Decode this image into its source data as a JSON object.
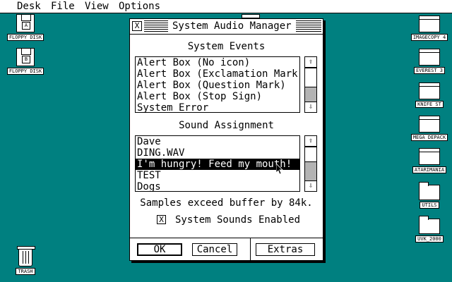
{
  "menubar": {
    "items": [
      "Desk",
      "File",
      "View",
      "Options"
    ]
  },
  "desktop": {
    "left_icons": [
      {
        "label": "FLOPPY DISK",
        "icon": "floppy-drive-icon",
        "letter": "A"
      },
      {
        "label": "FLOPPY DISK",
        "icon": "floppy-drive-icon",
        "letter": "B"
      }
    ],
    "right_icons": [
      {
        "label": "IMAGECOPY 4",
        "icon": "program-icon"
      },
      {
        "label": "EVEREST 3",
        "icon": "program-icon"
      },
      {
        "label": "KNIFE ST",
        "icon": "program-icon"
      },
      {
        "label": "MEGA DEPACK",
        "icon": "program-icon"
      },
      {
        "label": "ATARIMANIA",
        "icon": "program-icon"
      },
      {
        "label": "UTILS",
        "icon": "folder-icon"
      },
      {
        "label": "UVK_2000",
        "icon": "folder-icon"
      }
    ],
    "trash": {
      "label": "TRASH",
      "icon": "trash-icon"
    }
  },
  "dialog": {
    "title": "System Audio Manager",
    "close_glyph": "X",
    "events_heading": "System Events",
    "events": [
      "Alert Box (No icon)",
      "Alert Box (Exclamation Mark)",
      "Alert Box (Question Mark)",
      "Alert Box (Stop Sign)",
      "System Error"
    ],
    "assignment_heading": "Sound Assignment",
    "sounds": [
      "Dave",
      "DING.WAV",
      "I'm hungry! Feed my mouth!",
      "TEST",
      "Dogs"
    ],
    "selected_sound_index": 2,
    "scroll_up_glyph": "⇧",
    "scroll_down_glyph": "⇩",
    "status": "Samples exceed buffer by 84k.",
    "checkbox": {
      "label": "System Sounds Enabled",
      "checked": true,
      "glyph": "X"
    },
    "buttons": {
      "ok": "OK",
      "cancel": "Cancel",
      "extras": "Extras"
    }
  },
  "colors": {
    "desktop": "#008080",
    "window": "#ffffff",
    "ink": "#000000"
  }
}
